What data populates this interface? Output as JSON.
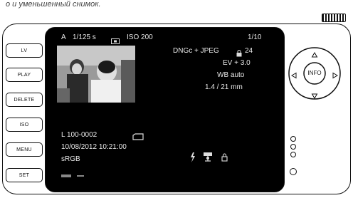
{
  "caption": "о и уменьшенный снимок.",
  "side_buttons": [
    "LV",
    "PLAY",
    "DELETE",
    "ISO",
    "MENU",
    "SET"
  ],
  "lcd": {
    "top_bar": {
      "mode": "A",
      "shutter": "1/125 s",
      "iso": "ISO 200",
      "frame_counter": "1/10"
    },
    "right_info": {
      "format": "DNGc + JPEG",
      "ev": "EV + 3.0",
      "wb": "WB auto",
      "aperture": "1.4 / 21 mm"
    },
    "bottom_left": {
      "file_id": "L 100-0002",
      "datetime": "10/08/2012  10:21:00",
      "color_space": "sRGB"
    }
  },
  "nav": {
    "center_label": "INFO"
  }
}
